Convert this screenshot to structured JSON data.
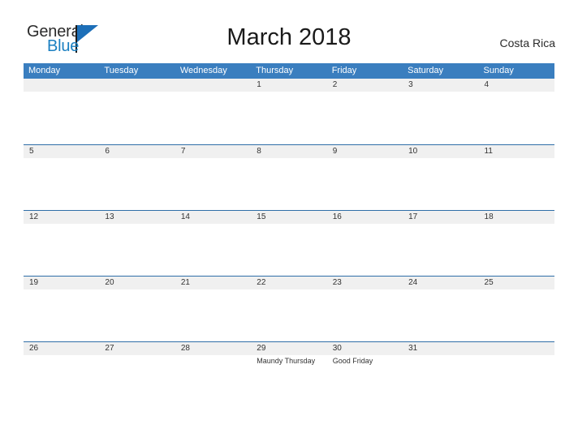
{
  "brand": {
    "name_part1": "General",
    "name_part2": "Blue",
    "flag_icon": "flag-icon"
  },
  "header": {
    "title": "March 2018",
    "region": "Costa Rica"
  },
  "colors": {
    "header_blue": "#3a7ebf",
    "row_rule_blue": "#2f6ea8",
    "band_gray": "#f0f0f0",
    "logo_blue": "#1a7fc1",
    "text_dark": "#333333"
  },
  "calendar": {
    "weekdays": [
      "Monday",
      "Tuesday",
      "Wednesday",
      "Thursday",
      "Friday",
      "Saturday",
      "Sunday"
    ],
    "weeks": [
      [
        {
          "date": ""
        },
        {
          "date": ""
        },
        {
          "date": ""
        },
        {
          "date": "1",
          "event": ""
        },
        {
          "date": "2",
          "event": ""
        },
        {
          "date": "3",
          "event": ""
        },
        {
          "date": "4",
          "event": ""
        }
      ],
      [
        {
          "date": "5",
          "event": ""
        },
        {
          "date": "6",
          "event": ""
        },
        {
          "date": "7",
          "event": ""
        },
        {
          "date": "8",
          "event": ""
        },
        {
          "date": "9",
          "event": ""
        },
        {
          "date": "10",
          "event": ""
        },
        {
          "date": "11",
          "event": ""
        }
      ],
      [
        {
          "date": "12",
          "event": ""
        },
        {
          "date": "13",
          "event": ""
        },
        {
          "date": "14",
          "event": ""
        },
        {
          "date": "15",
          "event": ""
        },
        {
          "date": "16",
          "event": ""
        },
        {
          "date": "17",
          "event": ""
        },
        {
          "date": "18",
          "event": ""
        }
      ],
      [
        {
          "date": "19",
          "event": ""
        },
        {
          "date": "20",
          "event": ""
        },
        {
          "date": "21",
          "event": ""
        },
        {
          "date": "22",
          "event": ""
        },
        {
          "date": "23",
          "event": ""
        },
        {
          "date": "24",
          "event": ""
        },
        {
          "date": "25",
          "event": ""
        }
      ],
      [
        {
          "date": "26",
          "event": ""
        },
        {
          "date": "27",
          "event": ""
        },
        {
          "date": "28",
          "event": ""
        },
        {
          "date": "29",
          "event": "Maundy Thursday"
        },
        {
          "date": "30",
          "event": "Good Friday"
        },
        {
          "date": "31",
          "event": ""
        },
        {
          "date": ""
        }
      ]
    ]
  }
}
